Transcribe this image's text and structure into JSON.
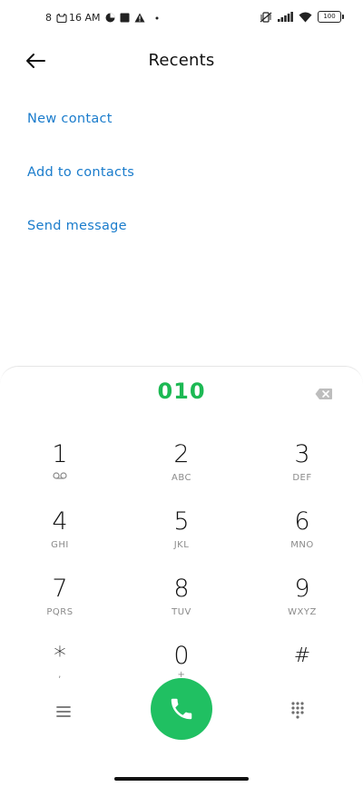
{
  "status_bar": {
    "time_prefix": "8",
    "time": "16 AM",
    "battery": "100"
  },
  "header": {
    "title": "Recents"
  },
  "actions": [
    {
      "label": "New contact"
    },
    {
      "label": "Add to contacts"
    },
    {
      "label": "Send message"
    }
  ],
  "dialer": {
    "number": "010",
    "keys": [
      {
        "digit": "1",
        "letters": ""
      },
      {
        "digit": "2",
        "letters": "ABC"
      },
      {
        "digit": "3",
        "letters": "DEF"
      },
      {
        "digit": "4",
        "letters": "GHI"
      },
      {
        "digit": "5",
        "letters": "JKL"
      },
      {
        "digit": "6",
        "letters": "MNO"
      },
      {
        "digit": "7",
        "letters": "PQRS"
      },
      {
        "digit": "8",
        "letters": "TUV"
      },
      {
        "digit": "9",
        "letters": "WXYZ"
      },
      {
        "digit": "*",
        "letters": ","
      },
      {
        "digit": "0",
        "letters": "+"
      },
      {
        "digit": "#",
        "letters": ""
      }
    ]
  },
  "colors": {
    "accent_green": "#20c062",
    "number_green": "#1db954",
    "link_blue": "#1a7ccc"
  }
}
